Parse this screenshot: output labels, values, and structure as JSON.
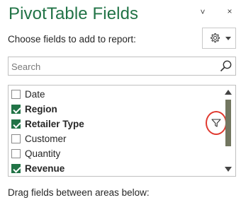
{
  "pane": {
    "title": "PivotTable Fields",
    "minimize_glyph": "˅",
    "close_glyph": "×",
    "choose_label": "Choose fields to add to report:",
    "tools_icon": "gear-icon",
    "accent_color": "#217346",
    "highlight_color": "#e03a30"
  },
  "search": {
    "placeholder": "Search",
    "value": ""
  },
  "fields": [
    {
      "label": "Date",
      "checked": false
    },
    {
      "label": "Region",
      "checked": true
    },
    {
      "label": "Retailer Type",
      "checked": true,
      "filtered": true
    },
    {
      "label": "Customer",
      "checked": false
    },
    {
      "label": "Quantity",
      "checked": false
    },
    {
      "label": "Revenue",
      "checked": true
    }
  ],
  "areas": {
    "drag_label": "Drag fields between areas below:"
  }
}
